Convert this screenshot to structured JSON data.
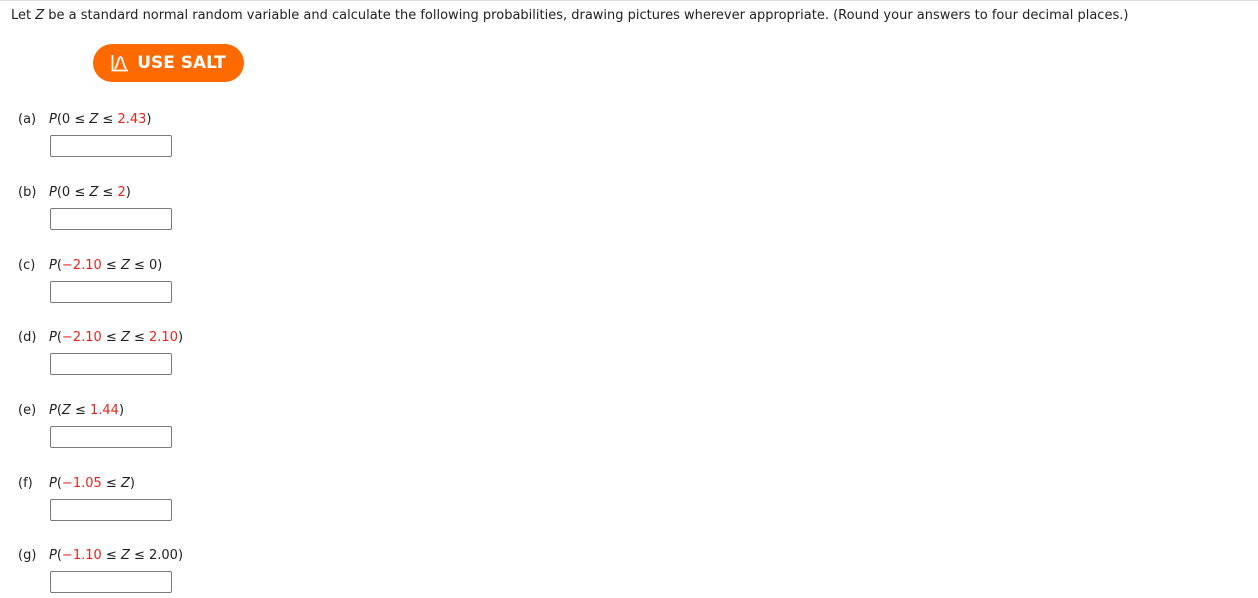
{
  "intro": {
    "prefix": "Let ",
    "variable": "Z",
    "suffix": " be a standard normal random variable and calculate the following probabilities, drawing pictures wherever appropriate. (Round your answers to four decimal places.)"
  },
  "salt_button": {
    "label": "USE SALT",
    "icon": "bell-curve-icon",
    "color": "#ff6a00"
  },
  "highlight_color": "#e8241d",
  "questions": [
    {
      "label": "(a)",
      "parts": [
        [
          "P(",
          "n"
        ],
        [
          "0 ≤ ",
          "n"
        ],
        [
          "Z",
          "i"
        ],
        [
          " ≤ ",
          "n"
        ],
        [
          "2.43",
          "r"
        ],
        [
          ")",
          "n"
        ]
      ],
      "answer": ""
    },
    {
      "label": "(b)",
      "parts": [
        [
          "P(",
          "n"
        ],
        [
          "0 ≤ ",
          "n"
        ],
        [
          "Z",
          "i"
        ],
        [
          " ≤ ",
          "n"
        ],
        [
          "2",
          "r"
        ],
        [
          ")",
          "n"
        ]
      ],
      "answer": ""
    },
    {
      "label": "(c)",
      "parts": [
        [
          "P(",
          "n"
        ],
        [
          "−2.10",
          "r"
        ],
        [
          " ≤ ",
          "n"
        ],
        [
          "Z",
          "i"
        ],
        [
          " ≤ 0)",
          "n"
        ]
      ],
      "answer": ""
    },
    {
      "label": "(d)",
      "parts": [
        [
          "P(",
          "n"
        ],
        [
          "−2.10",
          "r"
        ],
        [
          " ≤ ",
          "n"
        ],
        [
          "Z",
          "i"
        ],
        [
          " ≤ ",
          "n"
        ],
        [
          "2.10",
          "r"
        ],
        [
          ")",
          "n"
        ]
      ],
      "answer": ""
    },
    {
      "label": "(e)",
      "parts": [
        [
          "P(",
          "n"
        ],
        [
          "Z",
          "i"
        ],
        [
          " ≤ ",
          "n"
        ],
        [
          "1.44",
          "r"
        ],
        [
          ")",
          "n"
        ]
      ],
      "answer": ""
    },
    {
      "label": "(f)",
      "parts": [
        [
          "P(",
          "n"
        ],
        [
          "−1.05",
          "r"
        ],
        [
          " ≤ ",
          "n"
        ],
        [
          "Z",
          "i"
        ],
        [
          ")",
          "n"
        ]
      ],
      "answer": ""
    },
    {
      "label": "(g)",
      "parts": [
        [
          "P(",
          "n"
        ],
        [
          "−1.10",
          "r"
        ],
        [
          " ≤ ",
          "n"
        ],
        [
          "Z",
          "i"
        ],
        [
          " ≤ 2.00)",
          "n"
        ]
      ],
      "answer": ""
    }
  ]
}
